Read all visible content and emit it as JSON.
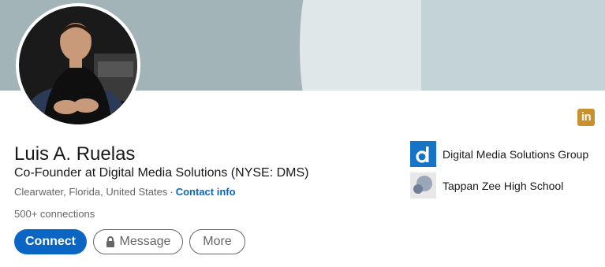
{
  "profile": {
    "name": "Luis A. Ruelas",
    "headline": "Co-Founder at Digital Media Solutions (NYSE: DMS)",
    "location": "Clearwater, Florida, United States",
    "separator": "·",
    "contact_info": "Contact info",
    "connections": "500+ connections"
  },
  "actions": {
    "connect": "Connect",
    "message": "Message",
    "more": "More"
  },
  "badge": {
    "text": "in",
    "color": "#c9902d"
  },
  "organizations": [
    {
      "name": "Digital Media Solutions Group",
      "icon": "dms-logo-icon",
      "logo_text": "d",
      "color": "#1674c6"
    },
    {
      "name": "Tappan Zee High School",
      "icon": "school-logo-icon"
    }
  ],
  "colors": {
    "primary": "#0a66c2",
    "cover": "#a2b4b8"
  }
}
